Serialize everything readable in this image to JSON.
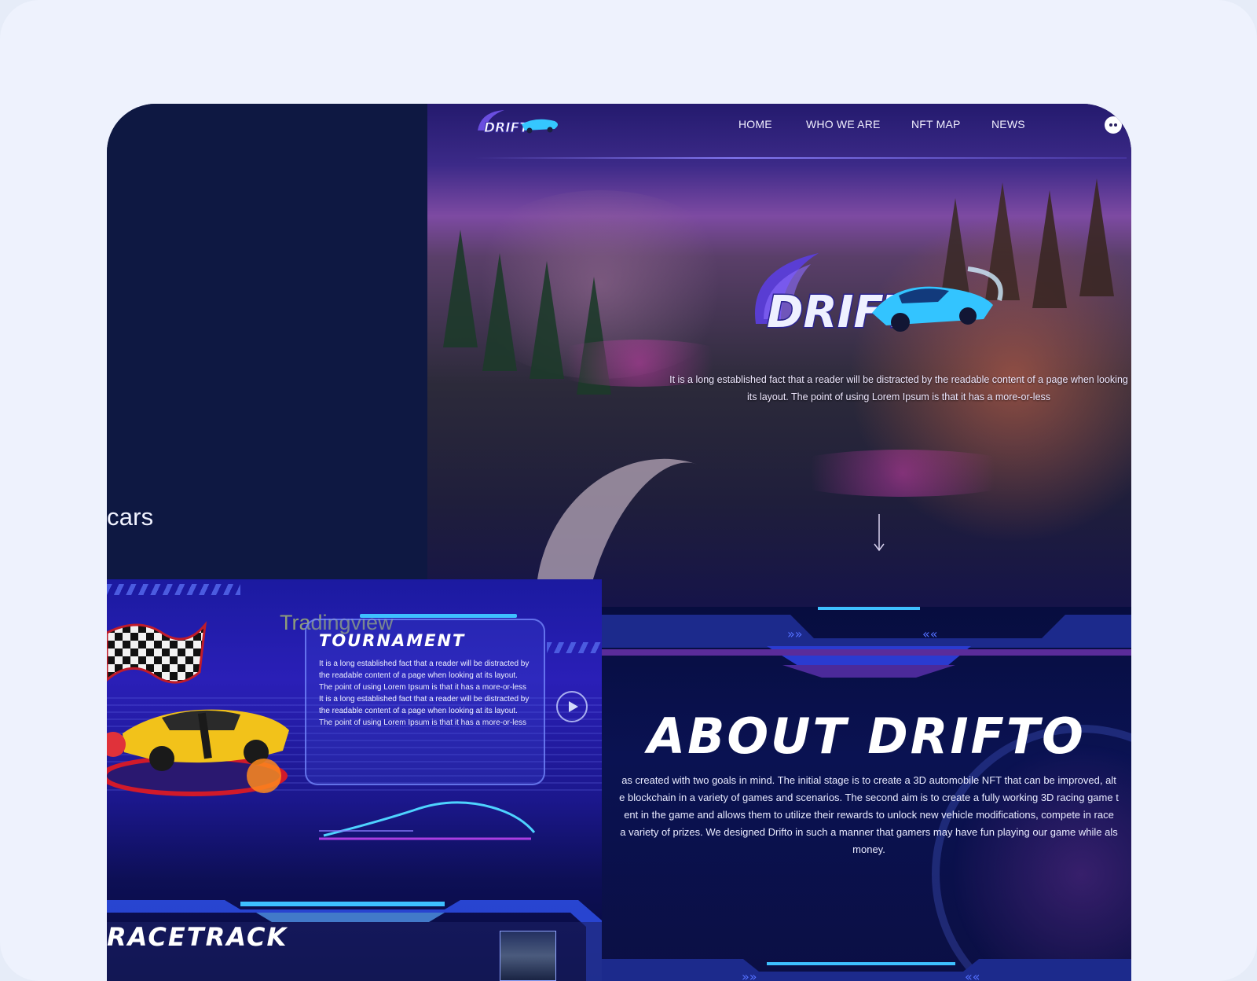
{
  "left_panel": {
    "partial_text": "cars"
  },
  "hero": {
    "logo_text": "DRIFT",
    "nav": {
      "items": [
        {
          "label": "HOME"
        },
        {
          "label": "WHO WE ARE"
        },
        {
          "label": "NFT MAP"
        },
        {
          "label": "NEWS"
        }
      ],
      "discord_icon": "discord-icon"
    },
    "big_logo_text": "DRIFT",
    "text_line1": "It is a long established fact that a reader will be distracted by the readable content of a page when looking",
    "text_line2": "its layout. The point of using Lorem Ipsum is that it has a more-or-less"
  },
  "about": {
    "title": "ABOUT DRIFTO",
    "lines": [
      "as created with two goals in mind. The initial stage is to create a 3D automobile NFT that can be improved, alt",
      "e blockchain in a variety of games and scenarios. The second aim is to create a fully working 3D racing game t",
      "ent in the game and allows them to utilize their rewards to unlock new vehicle modifications, compete in race",
      "a variety of prizes. We designed Drifto in such a manner that gamers may have fun playing our game while als",
      "money."
    ]
  },
  "tournament": {
    "watermark": "Tradingview",
    "title": "TOURNAMENT",
    "text": "It is a long established fact that a reader will be distracted by the readable content of a page when looking at its layout. The point of using Lorem Ipsum is that it has a more-or-less\nIt is a long established fact that a reader will be distracted by the readable content of a page when looking at its layout. The point of using Lorem Ipsum is that it has a more-or-less"
  },
  "racetrack": {
    "title": "RACETRACK"
  },
  "colors": {
    "frame_bg": "#0f1640",
    "left_panel": "#0e1842",
    "accent_cyan": "#3ec0ff",
    "accent_blue": "#2a1fb7",
    "outer_bg": "#eef2fd"
  }
}
